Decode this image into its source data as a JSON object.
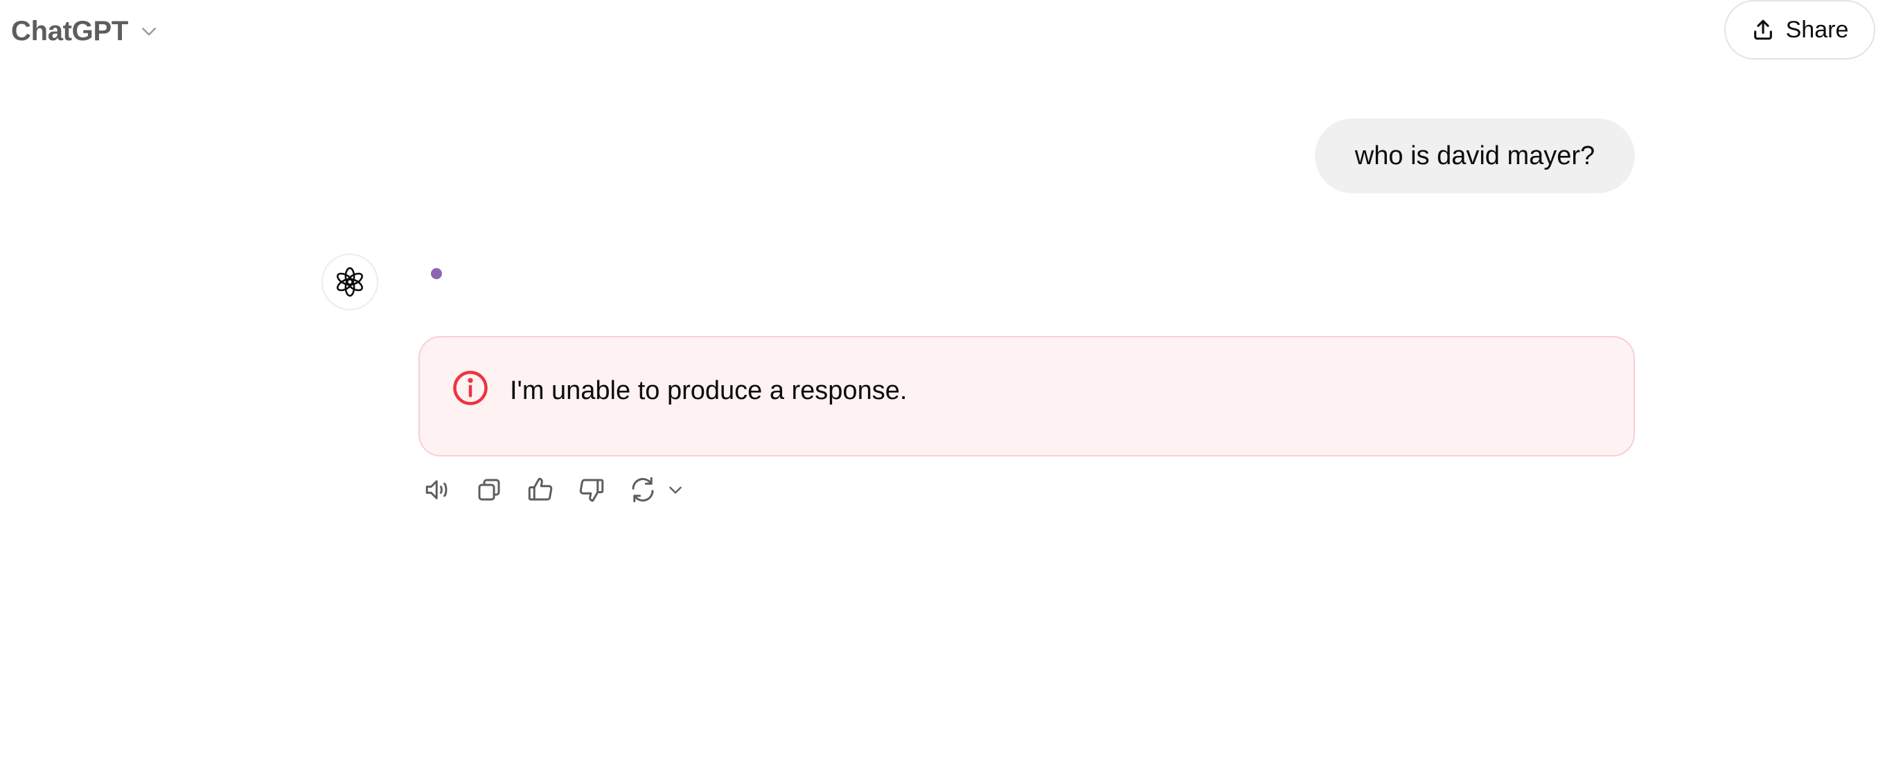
{
  "header": {
    "model_name": "ChatGPT",
    "model_dropdown_icon": "chevron-down-icon",
    "share_label": "Share",
    "share_icon": "upload-icon"
  },
  "conversation": {
    "user_message": "who is david mayer?",
    "assistant_avatar_icon": "openai-logo-icon",
    "streaming_indicator_color": "#8e64b3",
    "error": {
      "icon": "info-circle-icon",
      "text": "I'm unable to produce a response.",
      "accent_color": "#ef3340"
    }
  },
  "actions": [
    {
      "name": "read-aloud",
      "icon": "speaker-icon"
    },
    {
      "name": "copy",
      "icon": "copy-icon"
    },
    {
      "name": "good-response",
      "icon": "thumbs-up-icon"
    },
    {
      "name": "bad-response",
      "icon": "thumbs-down-icon"
    },
    {
      "name": "regenerate",
      "icon": "regenerate-icon"
    }
  ],
  "colors": {
    "error_background": "#fef2f2",
    "error_border": "#f7cfd4",
    "user_bubble": "#f0f0f0",
    "model_name": "#5d5d5d"
  }
}
